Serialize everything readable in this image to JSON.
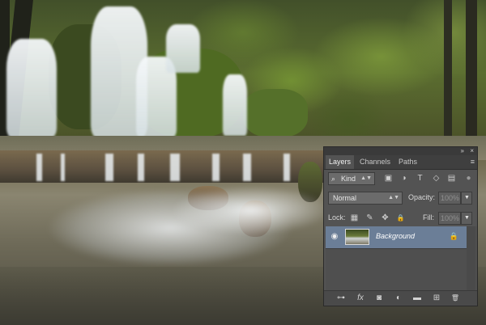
{
  "panel": {
    "tabs": [
      {
        "label": "Layers",
        "active": true
      },
      {
        "label": "Channels",
        "active": false
      },
      {
        "label": "Paths",
        "active": false
      }
    ],
    "filter": {
      "label": "Kind"
    },
    "blend_mode": "Normal",
    "opacity": {
      "label": "Opacity:",
      "value": "100%"
    },
    "lock": {
      "label": "Lock:"
    },
    "fill": {
      "label": "Fill:",
      "value": "100%"
    },
    "layers": [
      {
        "name": "Background",
        "visible": true,
        "locked": true,
        "selected": true
      }
    ]
  },
  "icons": {
    "collapse": "»",
    "close": "×",
    "panel_menu": "≡",
    "search": "⌕",
    "filter_pixel": "▣",
    "filter_adjust": "◑",
    "filter_type": "T",
    "filter_shape": "◇",
    "filter_smart": "▤",
    "toggle": "●",
    "lock_pixels": "▦",
    "lock_brush": "✎",
    "lock_move": "✥",
    "lock_all": "🔒",
    "eye": "◉",
    "layer_lock": "🔒",
    "link": "⊶",
    "fx": "fx",
    "mask": "◙",
    "adjustment": "◐",
    "group": "▬",
    "new_layer": "⊞",
    "trash": "🗑"
  },
  "colors": {
    "panel_bg": "#535353",
    "selected_layer": "#6b7e97"
  }
}
